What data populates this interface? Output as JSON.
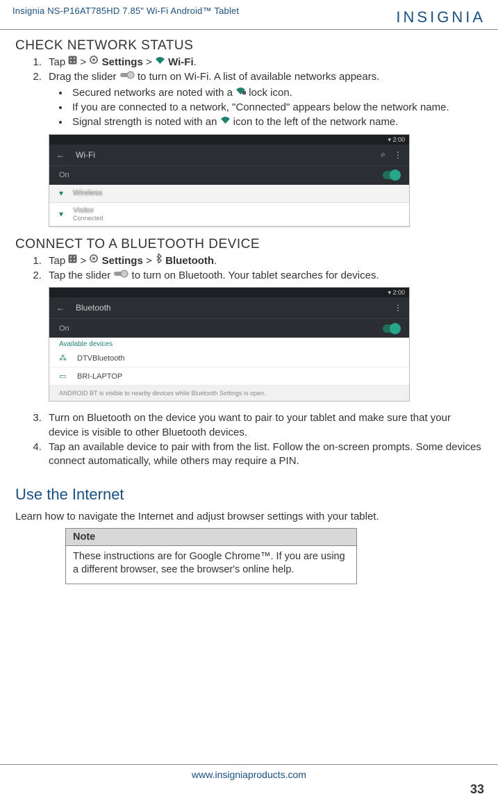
{
  "header": {
    "product_line": "Insignia   NS-P16AT785HD   7.85\" Wi-Fi Android™ Tablet",
    "brand": "INSIGNIA"
  },
  "section1": {
    "title": "CHECK NETWORK STATUS",
    "step1_pre": "Tap ",
    "step1_mid": " > ",
    "step1_settings": "Settings",
    "step1_sep": " > ",
    "step1_wifi": "Wi-Fi",
    "step1_end": ".",
    "step2_pre": "Drag the slider ",
    "step2_post": " to turn on Wi-Fi. A list of available networks appears.",
    "bullet1_pre": "Secured networks are noted with a ",
    "bullet1_post": " lock icon.",
    "bullet2": "If you are connected to a network, \"Connected\" appears below the network name.",
    "bullet3_pre": "Signal strength is noted with an ",
    "bullet3_post": " icon to the left of the network name."
  },
  "wifi_shot": {
    "time": "2:00",
    "back": "←",
    "title": "Wi-Fi",
    "search": "⌕",
    "menu": "⋮",
    "on": "On",
    "net1": "Wireless",
    "net2": "Visitor",
    "net2_sub": "Connected"
  },
  "section2": {
    "title": "CONNECT TO A BLUETOOTH DEVICE",
    "step1_pre": "Tap ",
    "step1_mid": " > ",
    "step1_settings": "Settings",
    "step1_sep": " > ",
    "step1_bt": "Bluetooth",
    "step1_end": ".",
    "step2_pre": "Tap the slider ",
    "step2_post": " to turn on Bluetooth. Your tablet searches for devices."
  },
  "bt_shot": {
    "time": "2:00",
    "back": "←",
    "title": "Bluetooth",
    "menu": "⋮",
    "on": "On",
    "avail": "Available devices",
    "dev1": "DTVBluetooth",
    "dev2": "BRI-LAPTOP",
    "foot": "ANDROID BT is visible to nearby devices while Bluetooth Settings is open."
  },
  "section2b": {
    "step3": "Turn on Bluetooth on the device you want to pair to your tablet and make sure that your device is visible to other Bluetooth devices.",
    "step4": "Tap an available device to pair with from the list. Follow the on-screen prompts. Some devices connect automatically, while others may require a PIN."
  },
  "internet": {
    "title": "Use the Internet",
    "lead": "Learn how to navigate the Internet and adjust browser settings with your tablet.",
    "note_label": "Note",
    "note_body": "These instructions are for Google Chrome™. If you are using a different browser, see the browser's online help."
  },
  "footer": {
    "url": "www.insigniaproducts.com",
    "page": "33"
  }
}
